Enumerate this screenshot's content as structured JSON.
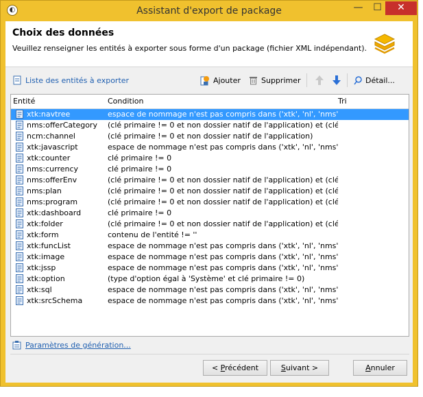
{
  "window": {
    "title": "Assistant d'export de package",
    "controls": {
      "minimize": "—",
      "maximize": "☐",
      "close": "✕"
    }
  },
  "header": {
    "title": "Choix des données",
    "subtitle": "Veuillez renseigner les entités à exporter sous forme d'un package (fichier XML indépendant)."
  },
  "toolbar": {
    "list_title": "Liste des entités à exporter",
    "add_label": "Ajouter",
    "delete_label": "Supprimer",
    "detail_label": "Détail..."
  },
  "table": {
    "columns": [
      "Entité",
      "Condition",
      "Tri"
    ],
    "rows": [
      {
        "entity": "xtk:navtree",
        "condition": "espace de nommage n'est pas compris dans ('xtk', 'nl', 'nms', ...",
        "selected": true
      },
      {
        "entity": "nms:offerCategory",
        "condition": "(clé primaire != 0 et non dossier natif de l'application) et (clé ..."
      },
      {
        "entity": "ncm:channel",
        "condition": "(clé primaire != 0 et non dossier natif de l'application)"
      },
      {
        "entity": "xtk:javascript",
        "condition": "espace de nommage n'est pas compris dans ('xtk', 'nl', 'nms', ..."
      },
      {
        "entity": "xtk:counter",
        "condition": "clé primaire != 0"
      },
      {
        "entity": "nms:currency",
        "condition": "clé primaire != 0"
      },
      {
        "entity": "nms:offerEnv",
        "condition": "(clé primaire != 0 et non dossier natif de l'application) et (clé ..."
      },
      {
        "entity": "nms:plan",
        "condition": "(clé primaire != 0 et non dossier natif de l'application) et (clé ..."
      },
      {
        "entity": "nms:program",
        "condition": "(clé primaire != 0 et non dossier natif de l'application) et (clé ..."
      },
      {
        "entity": "xtk:dashboard",
        "condition": "clé primaire != 0"
      },
      {
        "entity": "xtk:folder",
        "condition": "(clé primaire != 0 et non dossier natif de l'application) et (clé ..."
      },
      {
        "entity": "xtk:form",
        "condition": "contenu de l'entité != ''"
      },
      {
        "entity": "xtk:funcList",
        "condition": "espace de nommage n'est pas compris dans ('xtk', 'nl', 'nms', ..."
      },
      {
        "entity": "xtk:image",
        "condition": "espace de nommage n'est pas compris dans ('xtk', 'nl', 'nms', ..."
      },
      {
        "entity": "xtk:jssp",
        "condition": "espace de nommage n'est pas compris dans ('xtk', 'nl', 'nms', ..."
      },
      {
        "entity": "xtk:option",
        "condition": "(type d'option égal à 'Système' et clé primaire != 0)"
      },
      {
        "entity": "xtk:sql",
        "condition": "espace de nommage n'est pas compris dans ('xtk', 'nl', 'nms', ..."
      },
      {
        "entity": "xtk:srcSchema",
        "condition": "espace de nommage n'est pas compris dans ('xtk', 'nl', 'nms', ..."
      }
    ]
  },
  "params_link": "Paramètres de génération...",
  "buttons": {
    "prev_mn": "P",
    "prev_before": "< ",
    "prev_after": "récédent",
    "next_mn": "S",
    "next_after": "uivant >",
    "cancel_mn": "A",
    "cancel_after": "nnuler"
  },
  "colors": {
    "titlebar": "#f0c12e",
    "selection": "#3399ff",
    "link": "#1f5fb0",
    "close": "#c7302b"
  }
}
